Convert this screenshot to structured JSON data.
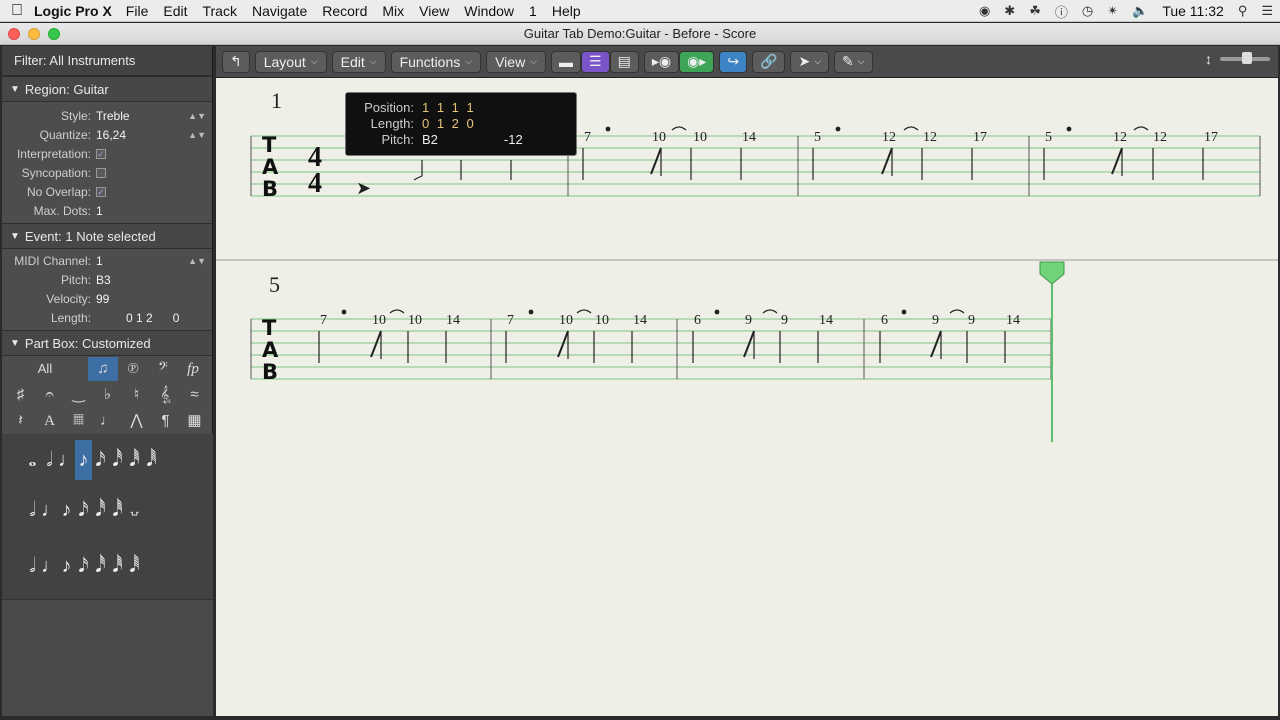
{
  "menubar": {
    "app_name": "Logic Pro X",
    "items": [
      "File",
      "Edit",
      "Track",
      "Navigate",
      "Record",
      "Mix",
      "View",
      "Window",
      "1",
      "Help"
    ],
    "clock": "Tue 11:32"
  },
  "window": {
    "title": "Guitar Tab Demo:Guitar - Before - Score"
  },
  "inspector": {
    "filter_label": "Filter:",
    "filter_value": "All Instruments",
    "region_label": "Region:",
    "region_value": "Guitar",
    "region_rows": [
      {
        "label": "Style:",
        "value": "Treble",
        "stepper": true
      },
      {
        "label": "Quantize:",
        "value": "16,24",
        "stepper": true
      },
      {
        "label": "Interpretation:",
        "value": "",
        "checked": true
      },
      {
        "label": "Syncopation:",
        "value": "",
        "checked": false
      },
      {
        "label": "No Overlap:",
        "value": "",
        "checked": true
      },
      {
        "label": "Max. Dots:",
        "value": "1"
      }
    ],
    "event_label": "Event:",
    "event_value": "1 Note selected",
    "event_rows": [
      {
        "label": "MIDI Channel:",
        "value": "1",
        "stepper": true
      },
      {
        "label": "Pitch:",
        "value": "B3"
      },
      {
        "label": "Velocity:",
        "value": "99"
      },
      {
        "label": "Length:",
        "value": "0 1 2      0"
      }
    ],
    "partbox_label": "Part Box:",
    "partbox_value": "Customized",
    "partbox_all": "All"
  },
  "toolbar": {
    "layout": "Layout",
    "edit": "Edit",
    "functions": "Functions",
    "view": "View"
  },
  "tooltip": {
    "position_label": "Position:",
    "position_value": "1 1 1 1",
    "length_label": "Length:",
    "length_value": "0 1 2 0",
    "pitch_label": "Pitch:",
    "pitch_value": "B2",
    "pitch_offset": "-12"
  },
  "score": {
    "system1_number": "1",
    "system2_number": "5",
    "tab_letters": [
      "T",
      "A",
      "B"
    ],
    "time_sig": [
      "4",
      "4"
    ],
    "system1_frets": [
      "7",
      "10",
      "10",
      "14",
      "5",
      "12",
      "12",
      "17",
      "5",
      "12",
      "12",
      "17"
    ],
    "system2_frets": [
      "7",
      "10",
      "10",
      "14",
      "7",
      "10",
      "10",
      "14",
      "6",
      "9",
      "9",
      "14",
      "6",
      "9",
      "9",
      "14"
    ]
  }
}
